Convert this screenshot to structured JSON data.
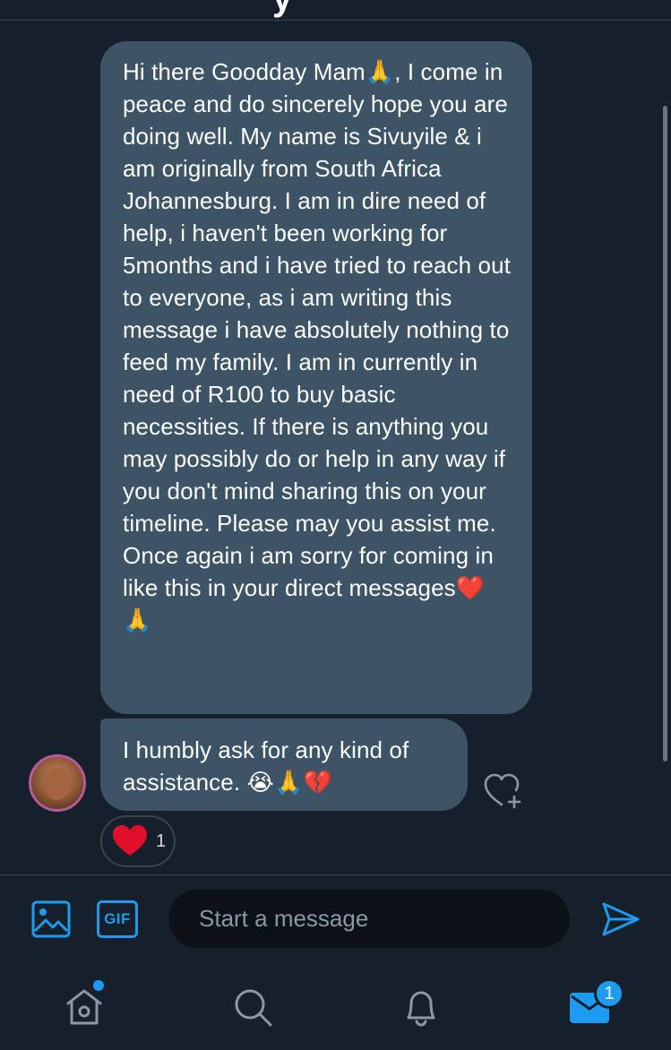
{
  "header": {
    "cut_title": "y"
  },
  "messages": [
    {
      "text": "Hi there Goodday Mam🙏, I come in peace and do sincerely hope you are doing well. My name is Sivuyile & i am originally from South Africa Johannesburg. I am in dire need of help, i haven't been working for 5months and i have tried to reach out to everyone, as i am writing this message i have absolutely nothing to feed my family. I am in currently in need of R100 to buy basic necessities. If there is anything you may possibly do or help in any way if you don't mind sharing this on your timeline. Please may you assist me. Once again i am sorry for coming in like this in your direct messages❤️ 🙏"
    },
    {
      "text": "I humbly ask for any kind of assistance. 😭🙏💔"
    }
  ],
  "reaction": {
    "emoji": "heart",
    "count": "1"
  },
  "composer": {
    "placeholder": "Start a message",
    "gif_label": "GIF"
  },
  "tabbar": {
    "mail_badge": "1"
  },
  "colors": {
    "background": "#15202b",
    "bubble": "#3d5466",
    "accent": "#1d9bf0",
    "input_bg": "#0b1117",
    "divider": "#38444d"
  },
  "icons": [
    "image-icon",
    "gif-icon",
    "send-icon",
    "home-icon",
    "search-icon",
    "bell-icon",
    "mail-icon",
    "heart-add-icon",
    "heart-icon"
  ]
}
